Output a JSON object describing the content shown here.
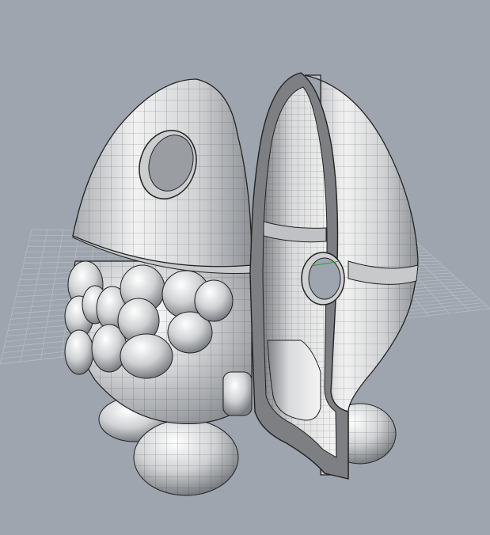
{
  "viewport": {
    "background_color": "#9ea5ae",
    "grid_color": "#b9bfc6",
    "axis_x_color": "#c0392b",
    "axis_y_color": "#2e9e3b",
    "model_fill": "#d9dadb",
    "model_shade": "#8e9196",
    "wire_color": "#1c1c1c",
    "section_fill": "#7d7f83"
  }
}
